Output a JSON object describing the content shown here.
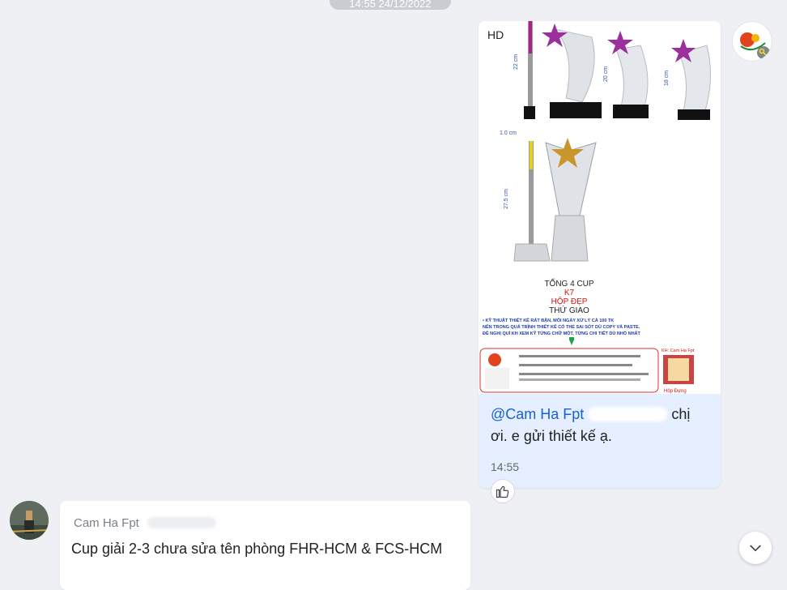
{
  "date_pill": "14:55 24/12/2022",
  "outgoing": {
    "image_badge": "HD",
    "image": {
      "dim_22": "22 cm",
      "dim_20": "20 cm",
      "dim_18": "18 cm",
      "dim_1cm": "1.0 cm",
      "dim_27": "27.5 cm",
      "total": "TỔNG 4 CUP",
      "code": "K7",
      "box": "HỘP ĐẸP",
      "delivery": "THỨ   GIAO",
      "note1": "• KỸ THUẬT THIẾT KẾ RẤT BẬN, MỖI NGÀY XỬ LÝ CẢ 100 TK",
      "note2": "NÊN TRONG QUÁ TRÌNH THIẾT KẾ CÓ THỂ SAI SÓT DÙ COPY VÀ PASTE.",
      "note3": "ĐỀ NGHỊ QUÍ KH XEM KỸ TỪNG CHỮ MỘT, TỪNG CHI TIẾT DÙ NHỎ NHẤT",
      "kh_label": "KH: Cam Ha Fpt",
      "box_label": "Hộp Đựng"
    },
    "mention": "@Cam Ha Fpt",
    "mention_tail": "chị",
    "text_line2": "ơi. e gửi thiết kế ạ.",
    "time": "14:55"
  },
  "incoming": {
    "sender": "Cam Ha Fpt",
    "message": "Cup giải 2-3 chưa sửa tên phòng FHR-HCM & FCS-HCM"
  },
  "colors": {
    "background": "#eef0f3",
    "caption_bg": "#e5efff",
    "mention": "#1a5fd6",
    "star": "#9b2f9e",
    "gold": "#c8962a"
  },
  "icons": {
    "like": "thumbs-up-icon",
    "scroll": "chevron-down-icon",
    "avatar_badge": "key-icon"
  }
}
